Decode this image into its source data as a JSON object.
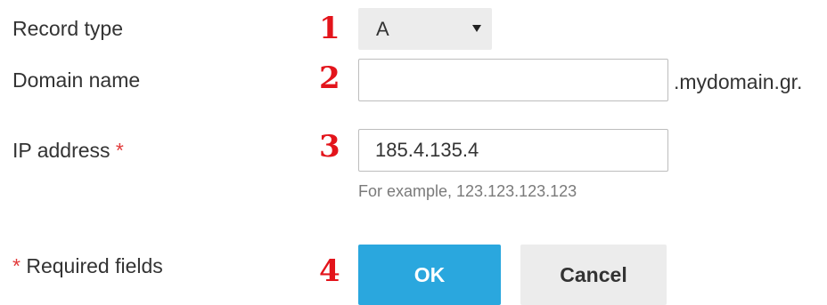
{
  "form": {
    "record_type": {
      "label": "Record type",
      "step": "1",
      "selected_value": "A"
    },
    "domain_name": {
      "label": "Domain name",
      "step": "2",
      "value": "",
      "suffix": ".mydomain.gr."
    },
    "ip_address": {
      "label": "IP address",
      "required_mark": "*",
      "step": "3",
      "value": "185.4.135.4",
      "hint": "For example, 123.123.123.123"
    },
    "required_note": {
      "mark": "*",
      "text": "Required fields",
      "step": "4"
    },
    "buttons": {
      "ok_label": "OK",
      "cancel_label": "Cancel"
    }
  },
  "colors": {
    "step_marker": "#e3141b",
    "required_star": "#e23a3a",
    "ok_button": "#2aa7de",
    "cancel_button": "#ececec",
    "select_background": "#ececec"
  }
}
